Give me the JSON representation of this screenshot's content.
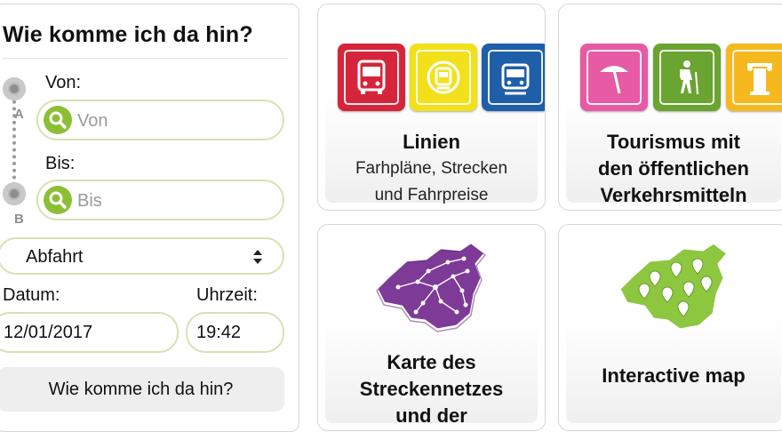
{
  "planner": {
    "title": "Wie komme ich da hin?",
    "from_label": "Von:",
    "from_placeholder": "Von",
    "to_label": "Bis:",
    "to_placeholder": "Bis",
    "marker_a": "A",
    "marker_b": "B",
    "mode_select": "Abfahrt",
    "date_label": "Datum:",
    "date_value": "12/01/2017",
    "time_label": "Uhrzeit:",
    "time_value": "19:42",
    "submit_label": "Wie komme ich da hin?"
  },
  "tiles": [
    {
      "title": "Linien",
      "subtitle_lines": [
        "Farhpläne, Strecken",
        "und Fahrpreise"
      ],
      "icons": [
        {
          "name": "bus-icon",
          "color": "#d6253a"
        },
        {
          "name": "metro-icon",
          "color": "#f2e11a"
        },
        {
          "name": "train-icon",
          "color": "#1f5ea8"
        }
      ]
    },
    {
      "title_lines": [
        "Tourismus mit",
        "den öffentlichen",
        "Verkehrsmitteln"
      ],
      "icons": [
        {
          "name": "beach-umbrella-icon",
          "color": "#e75aa4"
        },
        {
          "name": "hiker-icon",
          "color": "#6aa431"
        },
        {
          "name": "column-icon",
          "color": "#f5b81e"
        }
      ]
    },
    {
      "title_lines": [
        "Karte des",
        "Streckennetzes",
        "und der"
      ],
      "icon": {
        "name": "network-map-icon",
        "color": "#7e3a97"
      }
    },
    {
      "title": "Interactive map",
      "icon": {
        "name": "island-map-pins-icon",
        "color": "#8dc63f"
      }
    }
  ],
  "colors": {
    "field_border": "#d3e3b3",
    "search_green": "#8cbf36"
  }
}
